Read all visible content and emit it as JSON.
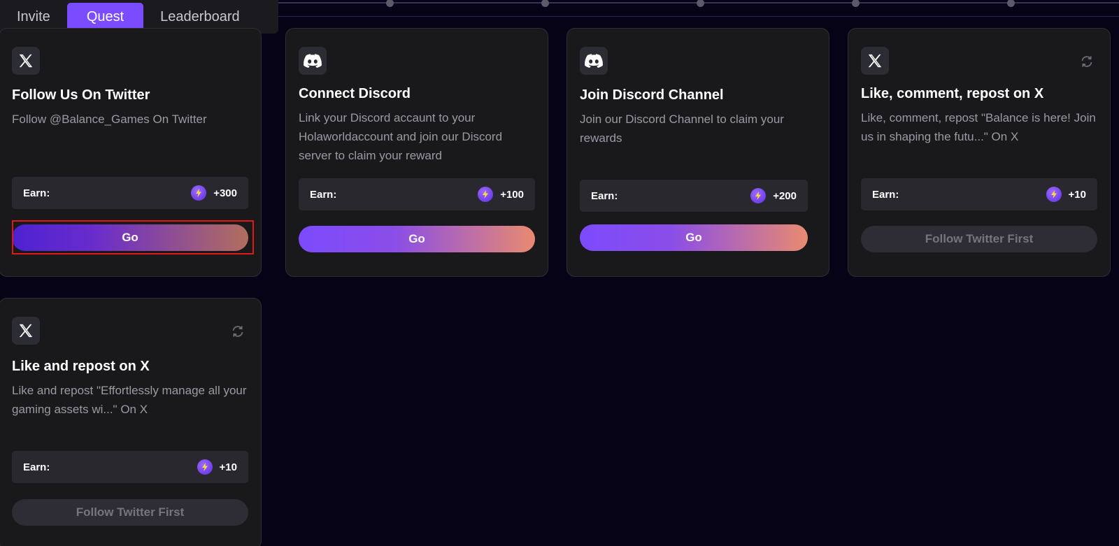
{
  "tabs": [
    {
      "label": "Invite"
    },
    {
      "label": "Quest"
    },
    {
      "label": "Leaderboard"
    }
  ],
  "active_tab": "Quest",
  "earn_label": "Earn:",
  "cards": [
    {
      "icon": "x-twitter-icon",
      "title": "Follow Us On Twitter",
      "description": "Follow @Balance_Games On Twitter",
      "reward": "+300",
      "button": "Go",
      "button_state": "enabled",
      "selected": true
    },
    {
      "icon": "discord-icon",
      "title": "Connect Discord",
      "description": "Link your Discord accaunt to your Holaworldaccount and join our Discord server to claim your reward",
      "reward": "+100",
      "button": "Go",
      "button_state": "enabled"
    },
    {
      "icon": "discord-icon",
      "title": "Join Discord Channel",
      "description": "Join our Discord Channel to claim your rewards",
      "reward": "+200",
      "button": "Go",
      "button_state": "enabled"
    },
    {
      "icon": "x-twitter-icon",
      "title": "Like, comment, repost on X",
      "description": "Like, comment, repost \"Balance is here! Join us in shaping the futu...\" On X",
      "reward": "+10",
      "button": "Follow Twitter First",
      "button_state": "disabled",
      "has_refresh": true
    },
    {
      "icon": "x-twitter-icon",
      "title": "Like and repost on X",
      "description": "Like and repost \"Effortlessly manage all your gaming assets wi...\" On X",
      "reward": "+10",
      "button": "Follow Twitter First",
      "button_state": "disabled",
      "has_refresh": true
    }
  ],
  "colors": {
    "background": "#050315",
    "card": "#19191c",
    "accent": "#7b4bff",
    "gradient_end": "#e98a70",
    "highlight": "#e01818"
  }
}
